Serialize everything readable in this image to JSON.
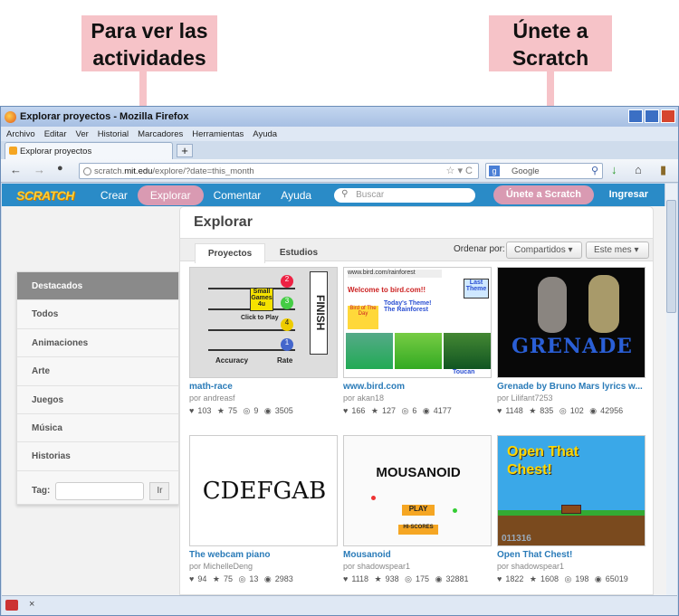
{
  "callouts": {
    "left": "Para ver las actividades",
    "right": "Únete a Scratch"
  },
  "browser": {
    "title": "Explorar proyectos - Mozilla Firefox",
    "menus": [
      "Archivo",
      "Editar",
      "Ver",
      "Historial",
      "Marcadores",
      "Herramientas",
      "Ayuda"
    ],
    "tab_title": "Explorar proyectos",
    "url_prefix": "scratch.",
    "url_domain": "mit.edu",
    "url_path": "/explore/?date=this_month",
    "search_placeholder": "Google"
  },
  "scratch_nav": {
    "logo": "SCRATCH",
    "crear": "Crear",
    "explorar": "Explorar",
    "comentar": "Comentar",
    "ayuda": "Ayuda",
    "search_placeholder": "Buscar",
    "join": "Únete a Scratch",
    "login": "Ingresar"
  },
  "page": {
    "title": "Explorar",
    "tabs": [
      "Proyectos",
      "Estudios"
    ],
    "sort_label": "Ordenar por:",
    "sort_value": "Compartidos",
    "date_value": "Este mes",
    "sidebar": [
      "Destacados",
      "Todos",
      "Animaciones",
      "Arte",
      "Juegos",
      "Música",
      "Historias"
    ],
    "tag_label": "Tag:",
    "tag_button": "Ir"
  },
  "projects": [
    {
      "title": "math-race",
      "author": "por andreasf",
      "loves": "103",
      "favs": "75",
      "remixes": "9",
      "views": "3505"
    },
    {
      "title": "www.bird.com",
      "author": "por akan18",
      "loves": "166",
      "favs": "127",
      "remixes": "6",
      "views": "4177"
    },
    {
      "title": "Grenade by Bruno Mars lyrics w...",
      "author": "por Lilifant7253",
      "loves": "1148",
      "favs": "835",
      "remixes": "102",
      "views": "42956"
    },
    {
      "title": "The webcam piano",
      "author": "por MichelleDeng",
      "loves": "94",
      "favs": "75",
      "remixes": "13",
      "views": "2983"
    },
    {
      "title": "Mousanoid",
      "author": "por shadowspear1",
      "loves": "1118",
      "favs": "938",
      "remixes": "175",
      "views": "32881"
    },
    {
      "title": "Open That Chest!",
      "author": "por shadowspear1",
      "loves": "1822",
      "favs": "1608",
      "remixes": "198",
      "views": "65019"
    }
  ],
  "thumb_text": {
    "math_sign": "FINISH",
    "math_small": "Small Games 4u",
    "math_click": "Click to Play",
    "math_acc": "Accuracy",
    "math_rate": "Rate",
    "bird_url": "www.bird.com/rainforest",
    "bird_welcome": "Welcome to bird.com!!",
    "bird_theme": "Today's Theme! The Rainforest",
    "bird_last": "Last Theme",
    "bird_day": "Bird of The Day",
    "bird_toucan": "Toucan",
    "grenade": "GRENADE",
    "piano": "CDEFGAB",
    "mouse_title": "MOUSANOID",
    "mouse_play": "PLAY",
    "mouse_scores": "HI-SCORES",
    "chest_title": "Open That Chest!",
    "chest_score": "011316"
  }
}
